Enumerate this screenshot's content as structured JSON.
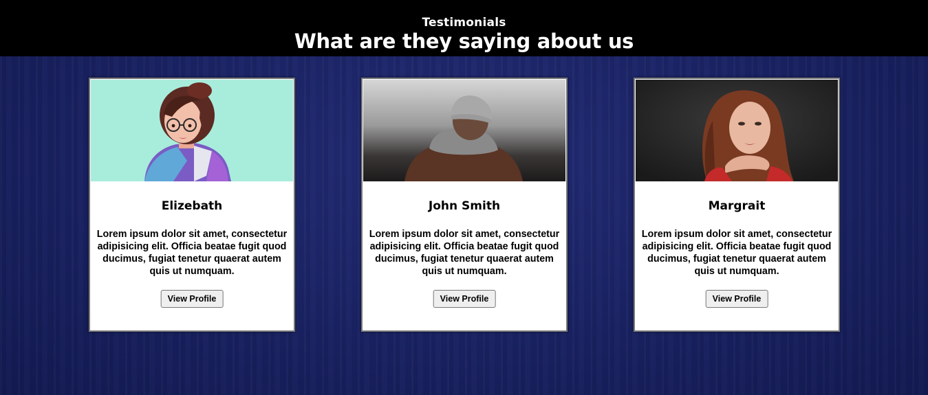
{
  "header": {
    "eyebrow": "Testimonials",
    "title": "What are they saying about us"
  },
  "colors": {
    "header_bg": "#000000",
    "page_bg": "#1a2263",
    "card_bg": "#ffffff",
    "avatar1_bg": "#a8ecdc"
  },
  "cards": [
    {
      "name": "Elizebath",
      "quote": "Lorem ipsum dolor sit amet, consectetur adipisicing elit. Officia beatae fugit quod ducimus, fugiat tenetur quaerat autem quis ut numquam.",
      "button": "View Profile"
    },
    {
      "name": "John Smith",
      "quote": "Lorem ipsum dolor sit amet, consectetur adipisicing elit. Officia beatae fugit quod ducimus, fugiat tenetur quaerat autem quis ut numquam.",
      "button": "View Profile"
    },
    {
      "name": "Margrait",
      "quote": "Lorem ipsum dolor sit amet, consectetur adipisicing elit. Officia beatae fugit quod ducimus, fugiat tenetur quaerat autem quis ut numquam.",
      "button": "View Profile"
    }
  ]
}
